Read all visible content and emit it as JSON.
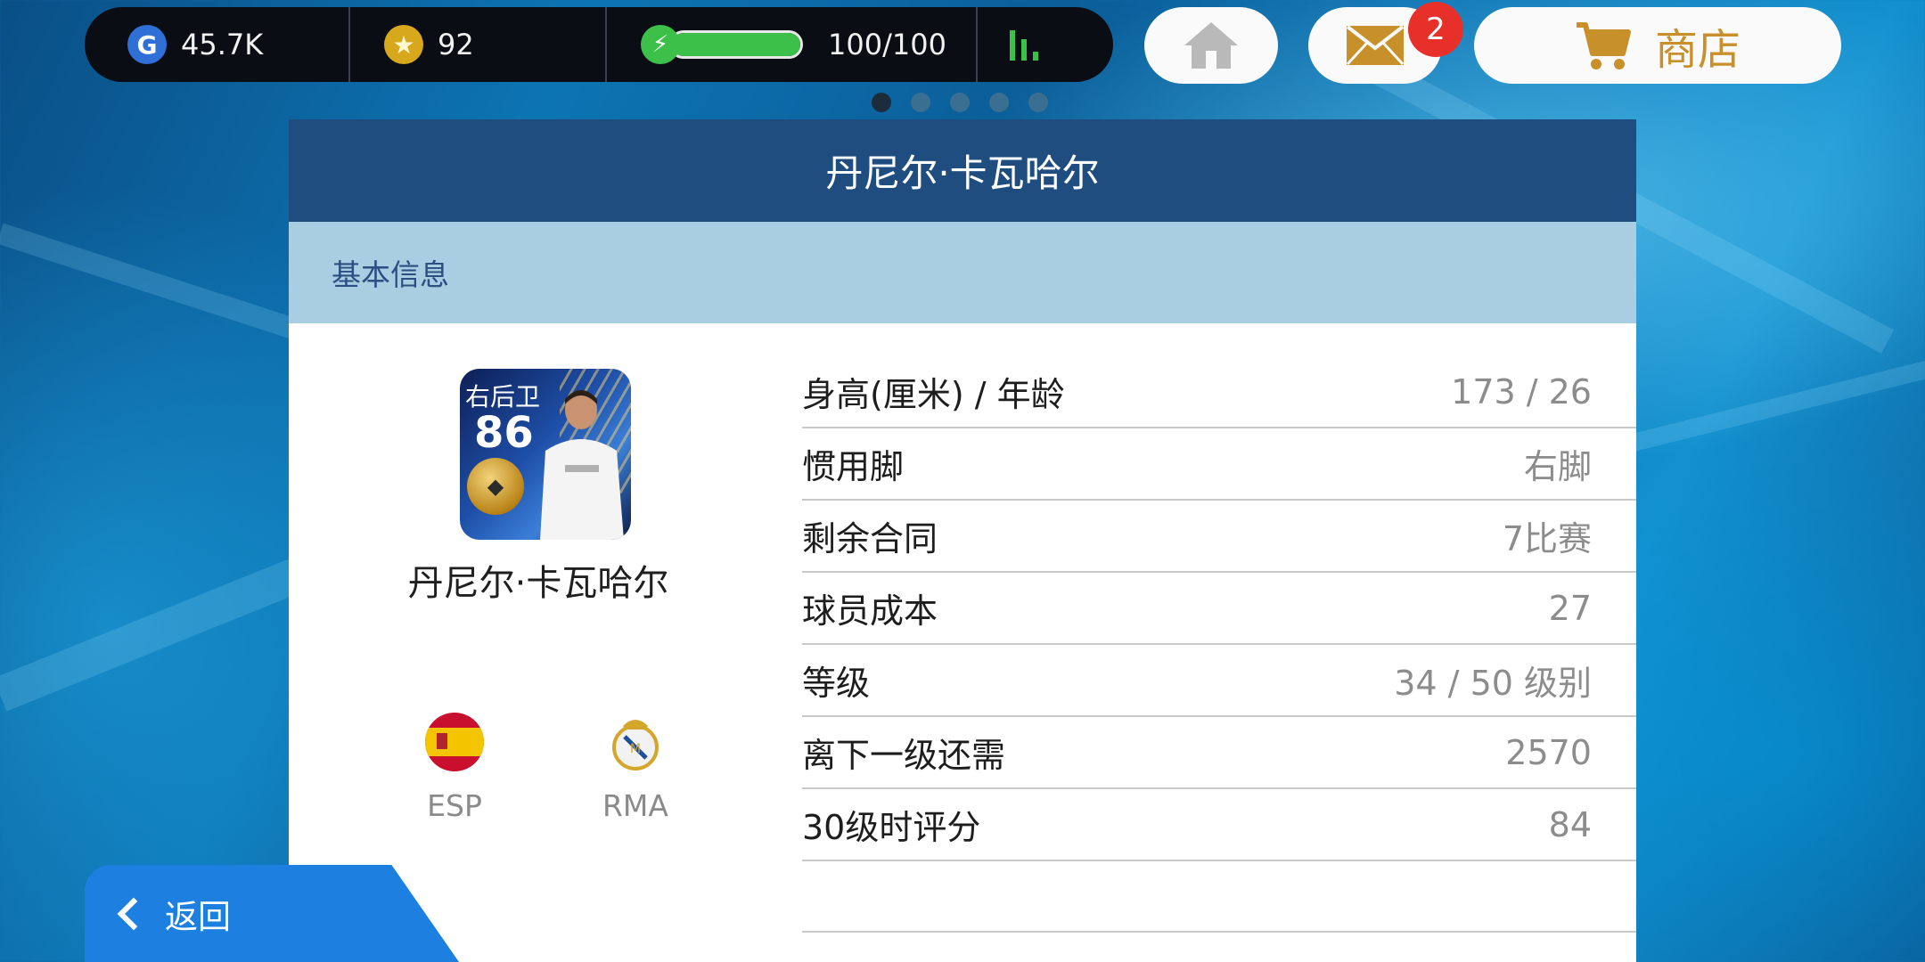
{
  "hud": {
    "gp_value": "45.7K",
    "coins_value": "92",
    "energy_value": "100/100",
    "energy_fraction": 1.0
  },
  "top_buttons": {
    "mail_badge": "2",
    "shop_label": "商店"
  },
  "pager": {
    "count": 5,
    "active_index": 0
  },
  "panel": {
    "title": "丹尼尔·卡瓦哈尔",
    "section_label": "基本信息"
  },
  "player": {
    "card_position": "右后卫",
    "card_rating": "86",
    "name": "丹尼尔·卡瓦哈尔",
    "nation": "ESP",
    "club": "RMA"
  },
  "stats": [
    {
      "label": "身高(厘米) / 年龄",
      "value": "173 / 26"
    },
    {
      "label": "惯用脚",
      "value": "右脚"
    },
    {
      "label": "剩余合同",
      "value": "7比赛"
    },
    {
      "label": "球员成本",
      "value": "27"
    },
    {
      "label": "等级",
      "value": "34 / 50 级别"
    },
    {
      "label": "离下一级还需",
      "value": "2570"
    },
    {
      "label": "30级时评分",
      "value": "84"
    }
  ],
  "back_button": {
    "label": "返回"
  },
  "colors": {
    "panel_header": "#1f4d80",
    "panel_subheader": "#a9cde1",
    "back_button": "#1d7fe0",
    "badge": "#e8302b",
    "shop_accent": "#c8902a",
    "energy": "#3cc04a"
  }
}
